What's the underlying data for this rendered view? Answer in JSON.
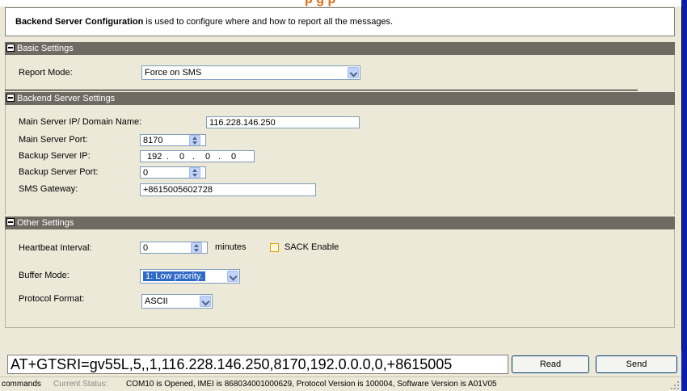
{
  "header": {
    "title_fragment": "p    g       p"
  },
  "description": {
    "bold_text": "Backend Server Configuration",
    "text": " is used to configure where and how to report all the messages."
  },
  "basic_settings": {
    "title": "Basic Settings",
    "report_mode_label": "Report Mode:",
    "report_mode_value": "Force on SMS"
  },
  "backend_server_settings": {
    "title": "Backend Server Settings",
    "main_server_label": "Main Server IP/ Domain Name:",
    "main_server_value": "116.228.146.250",
    "main_port_label": "Main Server Port:",
    "main_port_value": "8170",
    "backup_ip_label": "Backup Server IP:",
    "backup_ip_octets": [
      "192",
      "0",
      "0",
      "0"
    ],
    "backup_port_label": "Backup Server Port:",
    "backup_port_value": "0",
    "sms_gateway_label": "SMS Gateway:",
    "sms_gateway_value": "+8615005602728"
  },
  "other_settings": {
    "title": "Other Settings",
    "heartbeat_label": "Heartbeat Interval:",
    "heartbeat_value": "0",
    "heartbeat_unit": "minutes",
    "sack_label": "SACK Enable",
    "sack_checked": false,
    "buffer_label": "Buffer Mode:",
    "buffer_value": "1: Low priority.",
    "protocol_label": "Protocol Format:",
    "protocol_value": "ASCII"
  },
  "command": {
    "text": "AT+GTSRI=gv55L,5,,1,116.228.146.250,8170,192.0.0.0,0,+8615005",
    "read_label": "Read",
    "send_label": "Send"
  },
  "status": {
    "left_label": "commands",
    "current_status_label": "Current Status:",
    "message": "COM10 is Opened, IMEI is 868034001000629, Protocol Version is 100004, Software Version is A01V05"
  },
  "colors": {
    "section_header": "#6f6b63",
    "panel_bg": "#ece9d8",
    "right_bar": "#0b1ea8",
    "title_orange": "#e06a10"
  }
}
